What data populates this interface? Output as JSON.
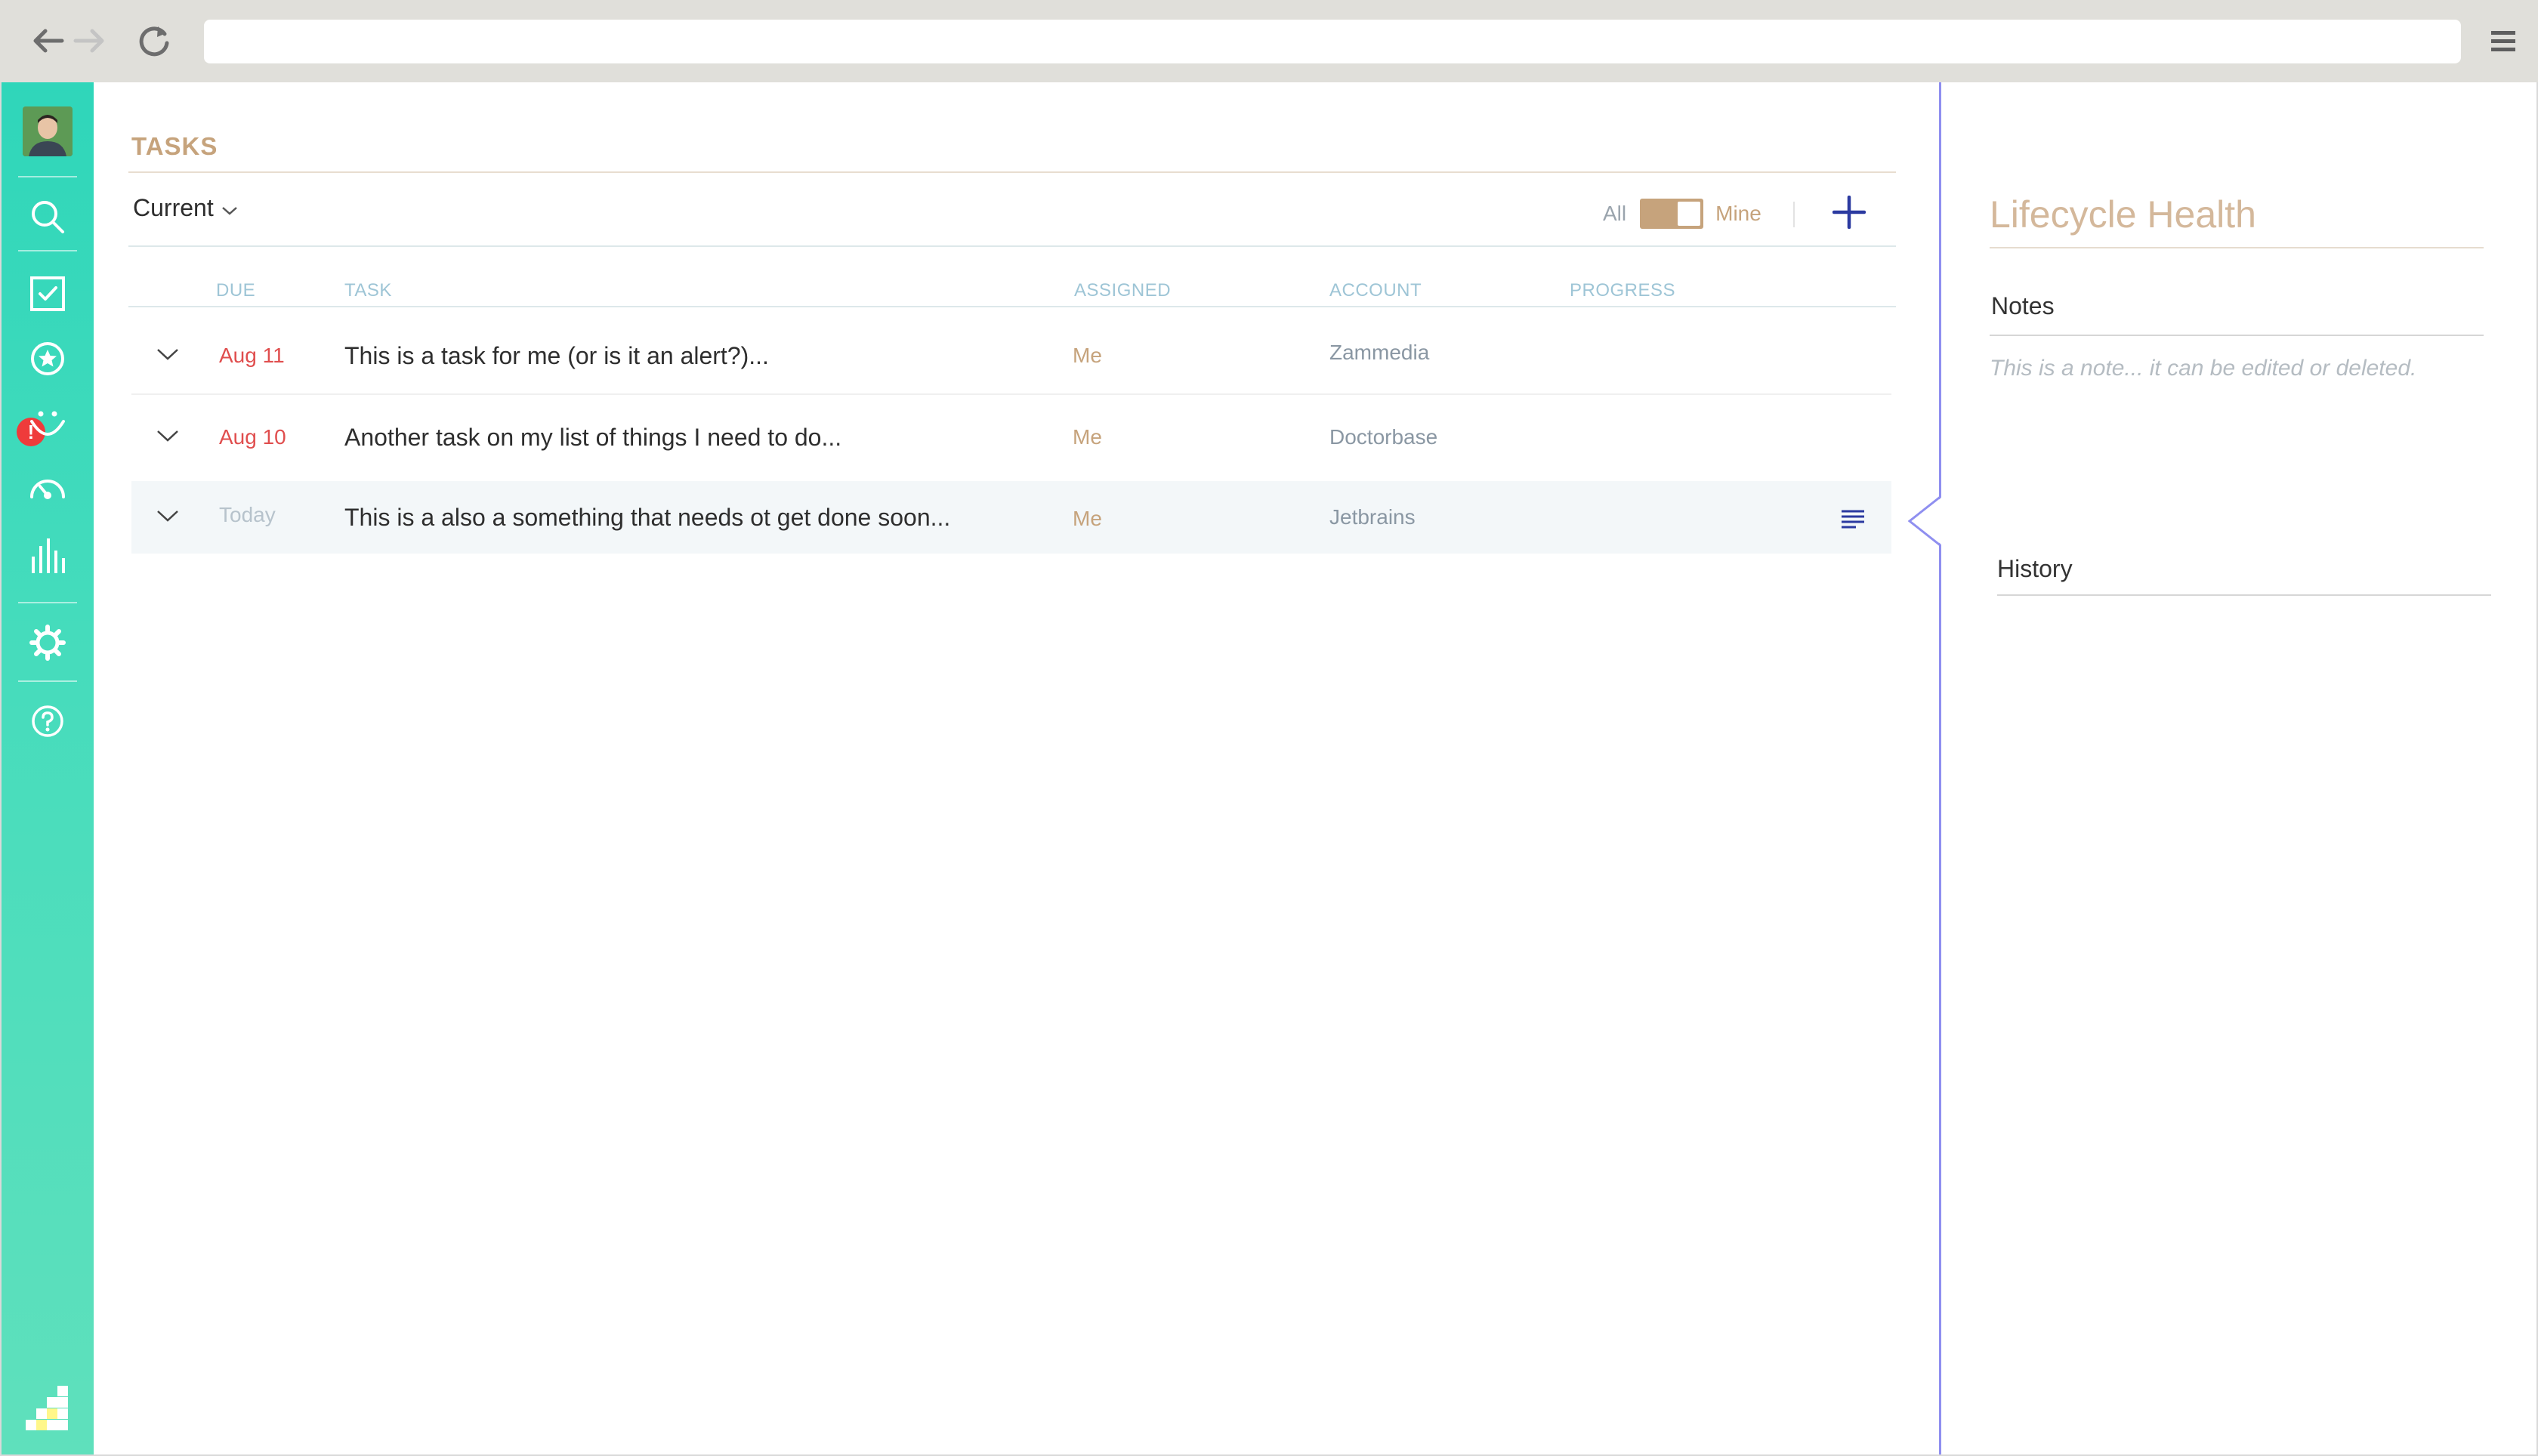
{
  "browser": {
    "url": ""
  },
  "sidebar": {
    "items": [
      {
        "icon": "search-icon"
      },
      {
        "icon": "checkbox-icon"
      },
      {
        "icon": "star-alert-icon",
        "badge": "!"
      },
      {
        "icon": "smiley-icon"
      },
      {
        "icon": "gauge-icon"
      },
      {
        "icon": "bar-chart-icon"
      },
      {
        "icon": "gear-icon"
      },
      {
        "icon": "help-icon"
      }
    ],
    "logo": "app-logo"
  },
  "tasks": {
    "title": "TASKS",
    "filter_label": "Current",
    "toggle_left": "All",
    "toggle_right": "Mine",
    "toggle_state": "Mine",
    "columns": {
      "due": "DUE",
      "task": "TASK",
      "assigned": "ASSIGNED",
      "account": "ACCOUNT",
      "progress": "PROGRESS"
    },
    "rows": [
      {
        "due": "Aug 11",
        "task": "This is a task for me (or is it an alert?)...",
        "assigned": "Me",
        "account": "Zammedia"
      },
      {
        "due": "Aug 10",
        "task": "Another task on my list of things I need to do...",
        "assigned": "Me",
        "account": "Doctorbase"
      },
      {
        "due": "Today",
        "task": "This is a also a something that needs ot get done soon...",
        "assigned": "Me",
        "account": "Jetbrains"
      }
    ]
  },
  "panel": {
    "title": "Lifecycle Health",
    "notes_heading": "Notes",
    "note_text": "This is a note... it can be edited or deleted.",
    "history_heading": "History"
  },
  "colors": {
    "accent": "#c6a37c",
    "overdue": "#e04e4e",
    "today": "#b7c3cc",
    "sidebar_top": "#2fd6ba",
    "sidebar_bottom": "#5fe0bc",
    "add_button": "#2b3aa0",
    "divider": "#8f8ff0"
  }
}
